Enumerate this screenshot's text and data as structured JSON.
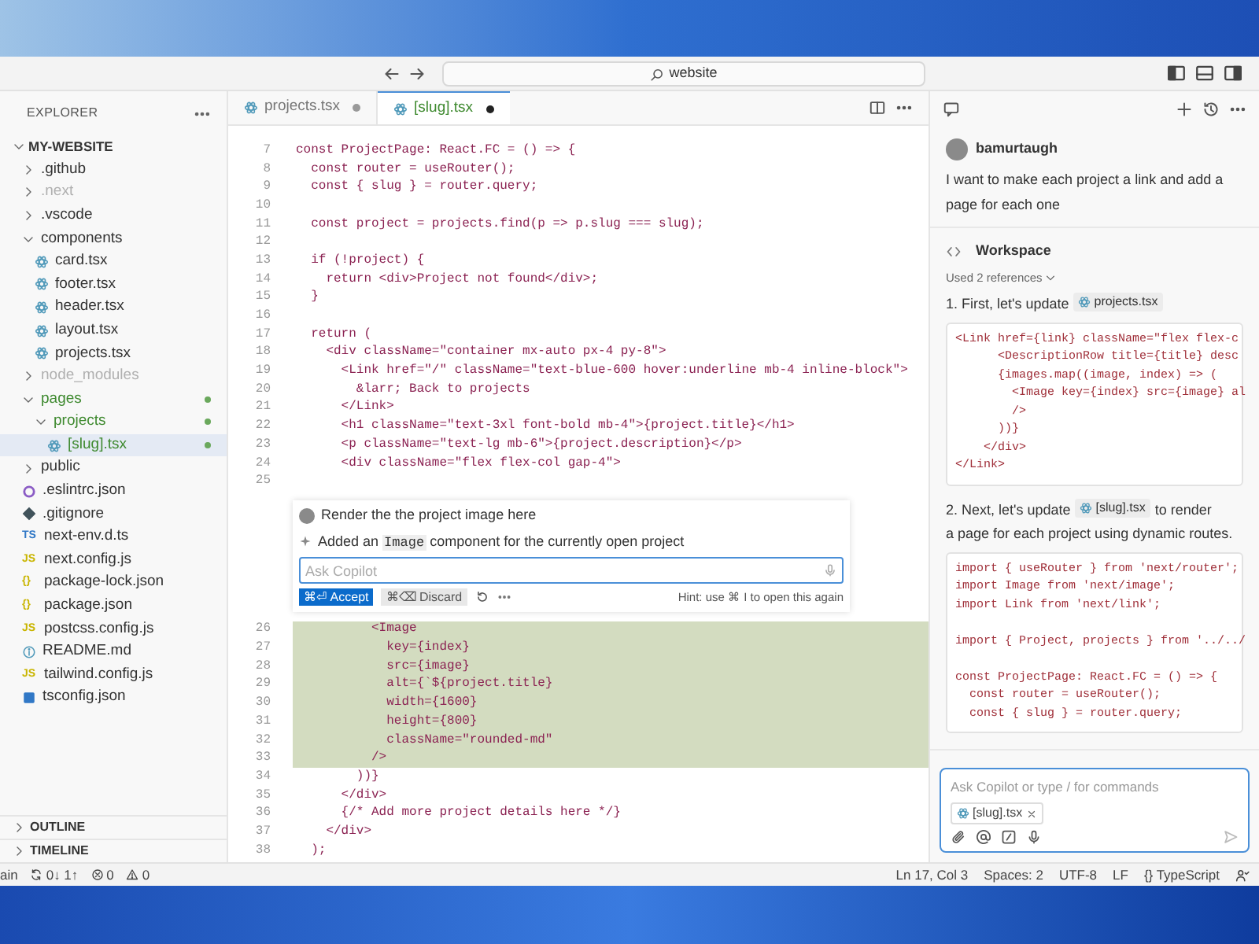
{
  "title_bar": {
    "search": "website"
  },
  "explorer": {
    "title": "EXPLORER",
    "root": {
      "label": "MY-WEBSITE",
      "expanded": true,
      "children": [
        {
          "label": ".github",
          "kind": "folder",
          "expanded": false,
          "dimmed": false,
          "modified": false,
          "selected": false
        },
        {
          "label": ".next",
          "kind": "folder",
          "expanded": false,
          "dimmed": true,
          "modified": false,
          "selected": false
        },
        {
          "label": ".vscode",
          "kind": "folder",
          "expanded": false,
          "dimmed": false,
          "modified": false,
          "selected": false
        },
        {
          "label": "components",
          "kind": "folder",
          "expanded": true,
          "dimmed": false,
          "modified": false,
          "selected": false,
          "children": [
            {
              "label": "card.tsx",
              "kind": "tsx",
              "dimmed": false,
              "modified": false,
              "selected": false
            },
            {
              "label": "footer.tsx",
              "kind": "tsx",
              "dimmed": false,
              "modified": false,
              "selected": false
            },
            {
              "label": "header.tsx",
              "kind": "tsx",
              "dimmed": false,
              "modified": false,
              "selected": false
            },
            {
              "label": "layout.tsx",
              "kind": "tsx",
              "dimmed": false,
              "modified": false,
              "selected": false
            },
            {
              "label": "projects.tsx",
              "kind": "tsx",
              "dimmed": false,
              "modified": false,
              "selected": false
            }
          ]
        },
        {
          "label": "node_modules",
          "kind": "folder",
          "expanded": false,
          "dimmed": true,
          "modified": false,
          "selected": false
        },
        {
          "label": "pages",
          "kind": "folder",
          "expanded": true,
          "dimmed": false,
          "modified": true,
          "selected": false,
          "children": [
            {
              "label": "projects",
              "kind": "folder",
              "expanded": true,
              "dimmed": false,
              "modified": true,
              "selected": false,
              "children": [
                {
                  "label": "[slug].tsx",
                  "kind": "tsx",
                  "dimmed": false,
                  "modified": true,
                  "selected": true
                }
              ]
            }
          ]
        },
        {
          "label": "public",
          "kind": "folder",
          "expanded": false,
          "dimmed": false,
          "modified": false,
          "selected": false
        },
        {
          "label": ".eslintrc.json",
          "kind": "eslint",
          "dimmed": false,
          "modified": false,
          "selected": false
        },
        {
          "label": ".gitignore",
          "kind": "git",
          "dimmed": false,
          "modified": false,
          "selected": false
        },
        {
          "label": "next-env.d.ts",
          "kind": "ts",
          "badge": "TS",
          "dimmed": false,
          "modified": false,
          "selected": false
        },
        {
          "label": "next.config.js",
          "kind": "js",
          "badge": "JS",
          "dimmed": false,
          "modified": false,
          "selected": false
        },
        {
          "label": "package-lock.json",
          "kind": "json",
          "badge": "{}",
          "dimmed": false,
          "modified": false,
          "selected": false
        },
        {
          "label": "package.json",
          "kind": "json",
          "badge": "{}",
          "dimmed": false,
          "modified": false,
          "selected": false
        },
        {
          "label": "postcss.config.js",
          "kind": "js",
          "badge": "JS",
          "dimmed": false,
          "modified": false,
          "selected": false
        },
        {
          "label": "README.md",
          "kind": "info",
          "dimmed": false,
          "modified": false,
          "selected": false
        },
        {
          "label": "tailwind.config.js",
          "kind": "js",
          "badge": "JS",
          "dimmed": false,
          "modified": false,
          "selected": false
        },
        {
          "label": "tsconfig.json",
          "kind": "tsconfig",
          "dimmed": false,
          "modified": false,
          "selected": false
        }
      ]
    },
    "sections": [
      {
        "label": "OUTLINE",
        "expanded": false
      },
      {
        "label": "TIMELINE",
        "expanded": false
      }
    ]
  },
  "tabs": [
    {
      "label": "projects.tsx",
      "selected": false,
      "modified": true
    },
    {
      "label": "[slug].tsx",
      "selected": true,
      "modified": true
    }
  ],
  "code_before": [
    {
      "number": "7",
      "text": "const ProjectPage: React.FC = () => {"
    },
    {
      "number": "8",
      "text": "  const router = useRouter();"
    },
    {
      "number": "9",
      "text": "  const { slug } = router.query;"
    },
    {
      "number": "10"
    },
    {
      "number": "11",
      "text": "  const project = projects.find(p => p.slug === slug);"
    },
    {
      "number": "12"
    },
    {
      "number": "13",
      "text": "  if (!project) {"
    },
    {
      "number": "14",
      "text": "    return <div>Project not found</div>;"
    },
    {
      "number": "15",
      "text": "  }"
    },
    {
      "number": "16"
    },
    {
      "number": "17",
      "text": "  return ("
    },
    {
      "number": "18",
      "text": "    <div className=\"container mx-auto px-4 py-8\">"
    },
    {
      "number": "19",
      "text": "      <Link href=\"/\" className=\"text-blue-600 hover:underline mb-4 inline-block\">"
    },
    {
      "number": "20",
      "text": "        &larr; Back to projects"
    },
    {
      "number": "21",
      "text": "      </Link>"
    },
    {
      "number": "22",
      "text": "      <h1 className=\"text-3xl font-bold mb-4\">{project.title}</h1>"
    },
    {
      "number": "23",
      "text": "      <p className=\"text-lg mb-6\">{project.description}</p>"
    },
    {
      "number": "24",
      "text": "      <div className=\"flex flex-col gap-4\">"
    },
    {
      "number": "25"
    }
  ],
  "inline_chat": {
    "prompt": "Render the the project image here",
    "summary": {
      "before": "Added an",
      "code": "Image",
      "after": "component for the currently open project"
    },
    "placeholder": "Ask Copilot",
    "accept": "⌘⏎ Accept",
    "discard": "⌘⌫ Discard",
    "hint": "Hint: use ⌘ I to open this again"
  },
  "code_after": [
    {
      "number": "26",
      "text": "          <Image",
      "added": true
    },
    {
      "number": "27",
      "text": "            key={index}",
      "added": true
    },
    {
      "number": "28",
      "text": "            src={image}",
      "added": true
    },
    {
      "number": "29",
      "text": "            alt={`${project.title}",
      "added": true
    },
    {
      "number": "30",
      "text": "            width={1600}",
      "added": true
    },
    {
      "number": "31",
      "text": "            height={800}",
      "added": true
    },
    {
      "number": "32",
      "text": "            className=\"rounded-md\"",
      "added": true
    },
    {
      "number": "33",
      "text": "          />",
      "added": true
    },
    {
      "number": "34",
      "text": "        ))}",
      "added": false
    },
    {
      "number": "35",
      "text": "      </div>",
      "added": false
    },
    {
      "number": "36",
      "text": "      {/* Add more project details here */}",
      "added": false
    },
    {
      "number": "37",
      "text": "    </div>",
      "added": false
    },
    {
      "number": "38",
      "text": "  );",
      "added": false
    }
  ],
  "chat": {
    "messages": [
      {
        "kind": "user",
        "author": "bamurtaugh",
        "text": "I want to make each project a link and add a page for each one"
      },
      {
        "kind": "assistant",
        "author": "Workspace",
        "references": "Used 2 references",
        "steps": [
          {
            "before": "1. First, let's update",
            "file": "projects.tsx",
            "code": [
              [
                "<Link href={link} className=\"flex flex-c",
                "      <DescriptionRow title={title} desc",
                "      {images.map((image, index) => (",
                "        <Image key={index} src={image} al",
                "        />",
                "      ))}",
                "    </div>",
                "</Link>"
              ]
            ]
          },
          {
            "before": "2. Next, let's update",
            "file": "[slug].tsx",
            "after": [
              "to render",
              "a page for each project using dynamic routes."
            ],
            "code": [
              [
                "import { useRouter } from 'next/router';",
                "import Image from 'next/image';",
                "import Link from 'next/link';"
              ],
              [
                "import { Project, projects } from '../../"
              ],
              [
                "const ProjectPage: React.FC = () => {",
                "  const router = useRouter();",
                "  const { slug } = router.query;"
              ]
            ]
          }
        ]
      }
    ],
    "input": {
      "placeholder": "Ask Copilot or type / for commands",
      "attachment": "[slug].tsx"
    }
  },
  "status_bar": {
    "left": [
      {
        "kind": "branch",
        "text": "ain"
      },
      {
        "kind": "sync",
        "text": "0↓ 1↑"
      },
      {
        "kind": "error",
        "text": "0"
      },
      {
        "kind": "warning",
        "text": "0"
      }
    ],
    "right": [
      "Ln 17, Col 3",
      "Spaces: 2",
      "UTF-8",
      "LF",
      "{} TypeScript"
    ]
  }
}
